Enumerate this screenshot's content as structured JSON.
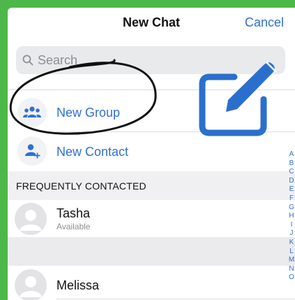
{
  "nav": {
    "title": "New Chat",
    "cancel_label": "Cancel"
  },
  "search": {
    "placeholder": "Search"
  },
  "actions": [
    {
      "label": "New Group",
      "icon": "group-icon"
    },
    {
      "label": "New Contact",
      "icon": "add-contact-icon"
    }
  ],
  "section": {
    "title": "FREQUENTLY CONTACTED"
  },
  "contacts": [
    {
      "name": "Tasha",
      "status": "Available"
    },
    {
      "name": "Melissa",
      "status": ""
    }
  ],
  "index_letters": [
    "A",
    "B",
    "C",
    "D",
    "E",
    "F",
    "G",
    "H",
    "I",
    "J",
    "K",
    "L",
    "M",
    "N",
    "O"
  ],
  "colors": {
    "accent": "#2f6fd1",
    "frame": "#4cb849",
    "annotation": "#2b6fce"
  },
  "annotation_icon": "compose-icon"
}
